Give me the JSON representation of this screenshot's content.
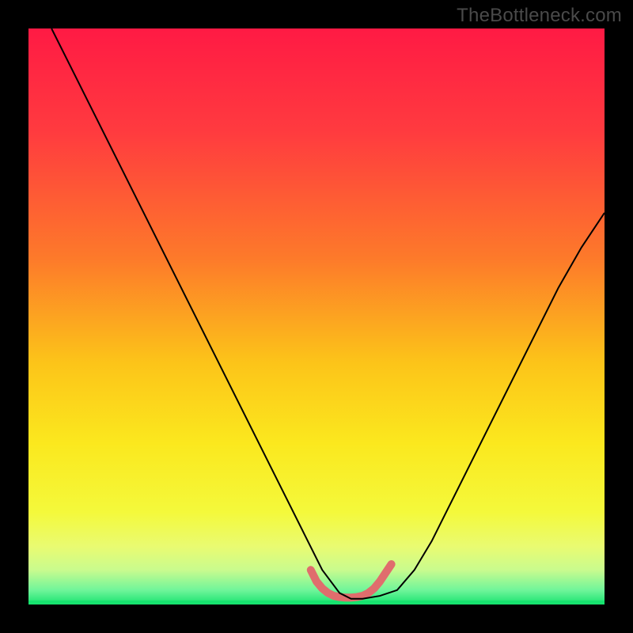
{
  "watermark": "TheBottleneck.com",
  "chart_data": {
    "type": "line",
    "title": "",
    "xlabel": "",
    "ylabel": "",
    "xlim": [
      0,
      100
    ],
    "ylim": [
      0,
      100
    ],
    "grid": false,
    "series": [
      {
        "name": "black-curve",
        "x": [
          4,
          8,
          12,
          16,
          20,
          24,
          28,
          32,
          36,
          40,
          44,
          48,
          51,
          54,
          56,
          58,
          61,
          64,
          67,
          70,
          73,
          76,
          80,
          84,
          88,
          92,
          96,
          100
        ],
        "y": [
          100,
          92,
          84,
          76,
          68,
          60,
          52,
          44,
          36,
          28,
          20,
          12,
          6,
          2,
          1,
          1,
          1.5,
          2.5,
          6,
          11,
          17,
          23,
          31,
          39,
          47,
          55,
          62,
          68
        ]
      },
      {
        "name": "pink-trough-marker",
        "x": [
          49,
          50,
          51,
          52,
          53,
          54,
          55,
          56,
          57,
          58,
          59,
          60,
          61,
          62,
          63
        ],
        "y": [
          6,
          4,
          2.8,
          2,
          1.5,
          1.3,
          1.2,
          1.2,
          1.3,
          1.5,
          2,
          2.8,
          4,
          5.5,
          7
        ]
      },
      {
        "name": "green-baseline",
        "x": [
          0,
          100
        ],
        "y": [
          0.3,
          0.3
        ]
      }
    ],
    "background_gradient_stops": [
      {
        "offset": 0.0,
        "color": "#ff1a44"
      },
      {
        "offset": 0.18,
        "color": "#ff3b3f"
      },
      {
        "offset": 0.4,
        "color": "#fd7a2a"
      },
      {
        "offset": 0.58,
        "color": "#fcc419"
      },
      {
        "offset": 0.72,
        "color": "#fbe81e"
      },
      {
        "offset": 0.84,
        "color": "#f4f93b"
      },
      {
        "offset": 0.9,
        "color": "#e9fb72"
      },
      {
        "offset": 0.94,
        "color": "#c9fb8e"
      },
      {
        "offset": 0.975,
        "color": "#70f59a"
      },
      {
        "offset": 1.0,
        "color": "#17e36f"
      }
    ],
    "styles": {
      "black-curve": {
        "stroke": "#000000",
        "stroke_width": 2
      },
      "pink-trough-marker": {
        "stroke": "#e06d6d",
        "stroke_width": 10,
        "linecap": "round"
      },
      "green-baseline": {
        "stroke": "#17e36f",
        "stroke_width": 6
      }
    }
  }
}
